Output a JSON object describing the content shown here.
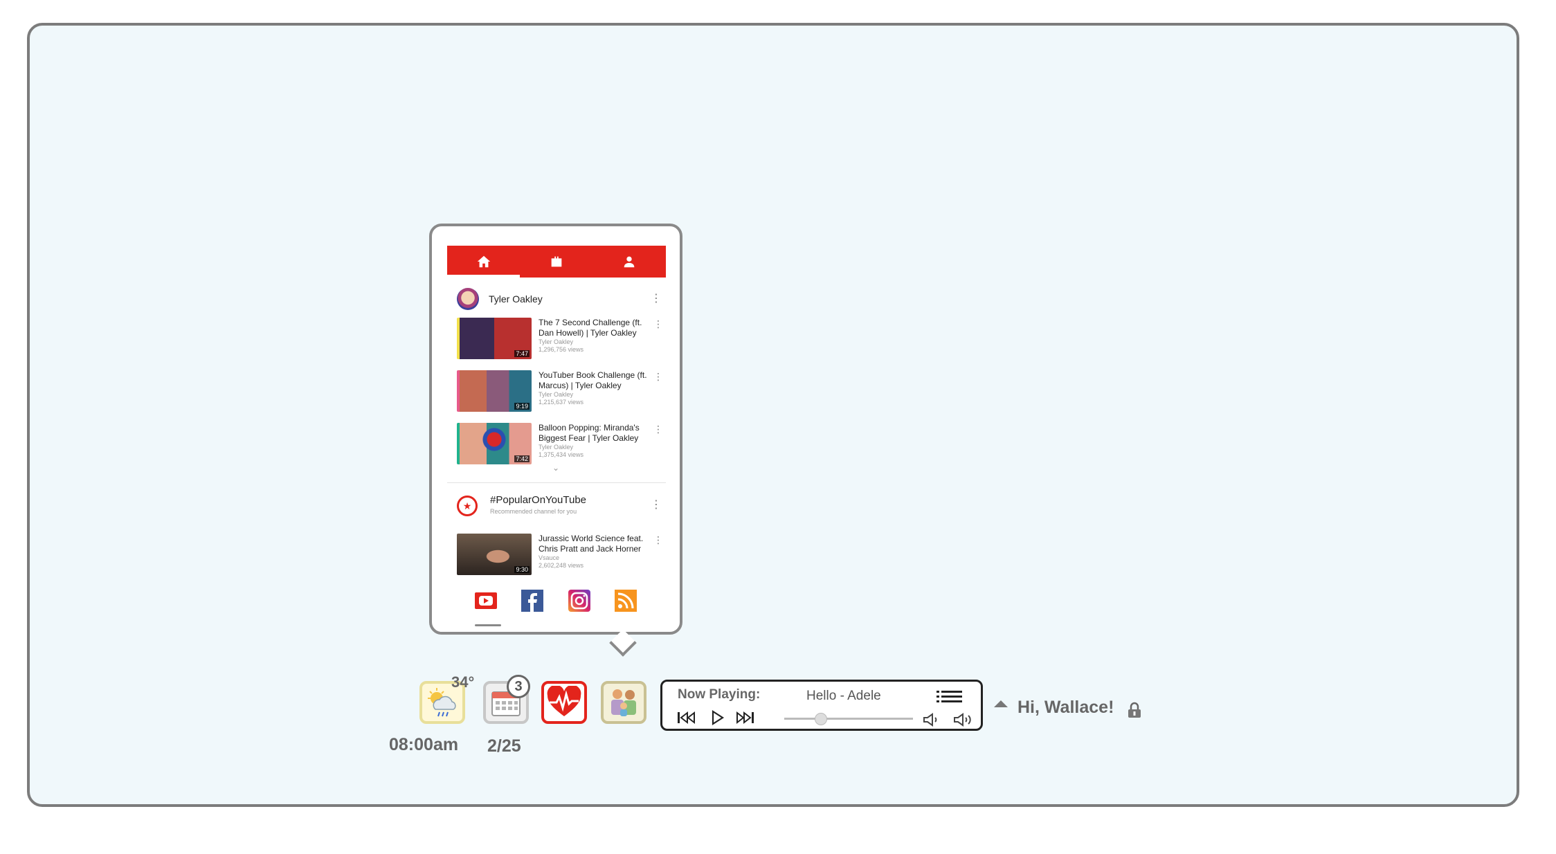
{
  "popup": {
    "tabs": [
      {
        "icon": "home-icon",
        "active": true
      },
      {
        "icon": "briefcase-icon",
        "active": false
      },
      {
        "icon": "account-icon",
        "active": false
      }
    ],
    "channel": "Tyler Oakley",
    "videos": [
      {
        "title": "The 7 Second Challenge (ft. Dan Howell) | Tyler Oakley",
        "channel": "Tyler Oakley",
        "views": "1,296,756 views",
        "duration": "7:47"
      },
      {
        "title": "YouTuber Book Challenge (ft. Marcus) | Tyler Oakley",
        "channel": "Tyler Oakley",
        "views": "1,215,637 views",
        "duration": "9:19"
      },
      {
        "title": "Balloon Popping: Miranda's Biggest Fear | Tyler Oakley",
        "channel": "Tyler Oakley",
        "views": "1,375,434 views",
        "duration": "7:42"
      }
    ],
    "popular": {
      "title": "#PopularOnYouTube",
      "subtitle": "Recommended channel for you",
      "video": {
        "title": "Jurassic World Science feat. Chris Pratt and Jack Horner",
        "channel": "Vsauce",
        "views": "2,602,248 views",
        "duration": "9:30"
      }
    },
    "social_icons": [
      "youtube-icon",
      "facebook-icon",
      "instagram-icon",
      "rss-icon"
    ]
  },
  "taskbar": {
    "temperature": "34°",
    "calendar_badge": "3",
    "time": "08:00am",
    "date": "2/25"
  },
  "player": {
    "label": "Now Playing:",
    "song": "Hello - Adele",
    "progress": 0.28
  },
  "greeting": "Hi, Wallace!",
  "colors": {
    "youtube_red": "#e3241c",
    "frame_border": "#7c7c7c",
    "background": "#f0f8fb"
  }
}
